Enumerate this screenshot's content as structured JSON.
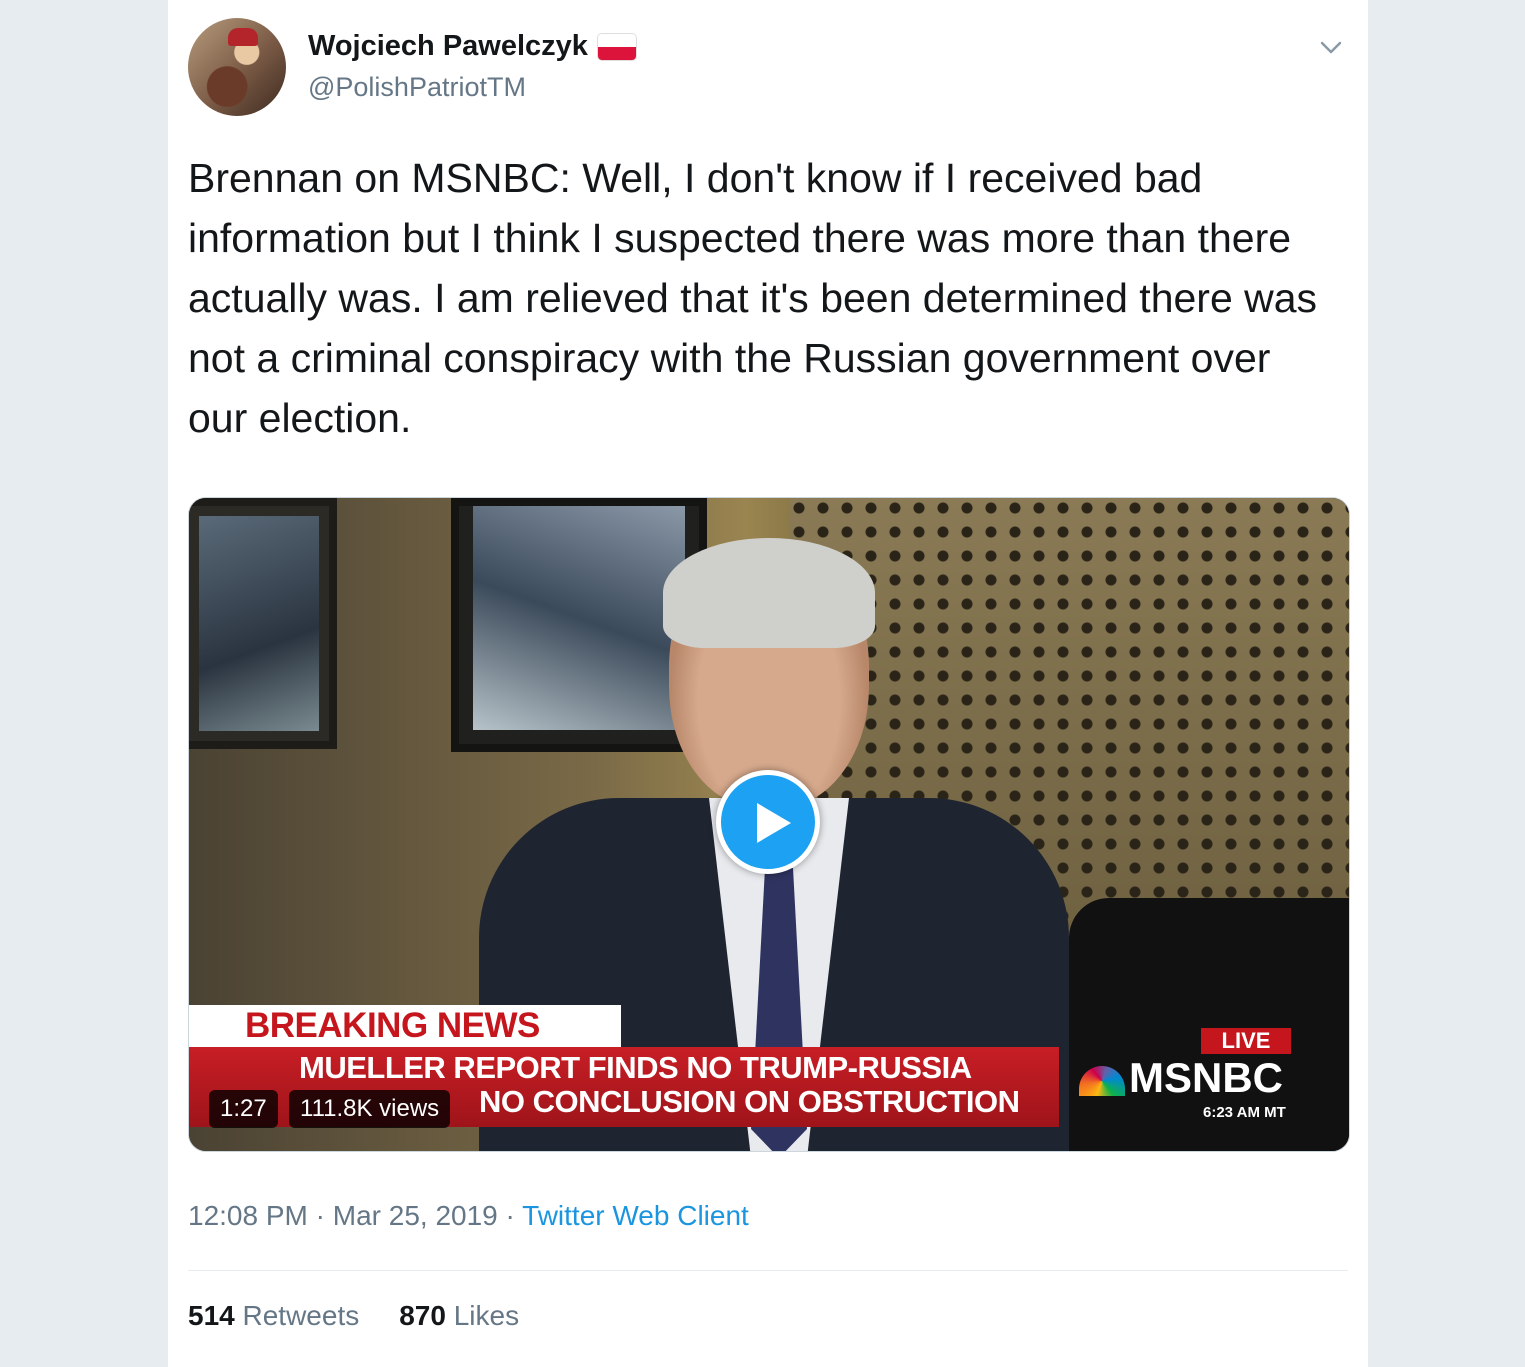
{
  "user": {
    "display_name": "Wojciech Pawelczyk",
    "handle": "@PolishPatriotTM",
    "flag_icon": "poland-flag-icon"
  },
  "tweet": {
    "text": "Brennan on MSNBC: Well, I don't know if I received bad information but I think I suspected there was more than there actually was. I am relieved that it's been determined there was not a criminal conspiracy with the Russian government over our election."
  },
  "video": {
    "duration": "1:27",
    "views": "111.8K views",
    "overlay": {
      "breaking": "BREAKING NEWS",
      "headline_line1": "MUELLER REPORT FINDS NO TRUMP-RUSSIA",
      "headline_line2": "NO CONCLUSION ON OBSTRUCTION",
      "live": "LIVE",
      "network": "MSNBC",
      "clock": "6:23 AM MT"
    }
  },
  "meta": {
    "time": "12:08 PM",
    "separator": " · ",
    "date": "Mar 25, 2019",
    "client": "Twitter Web Client"
  },
  "stats": {
    "retweets_count": "514",
    "retweets_label": "Retweets",
    "likes_count": "870",
    "likes_label": "Likes"
  },
  "colors": {
    "accent": "#1da1f2",
    "link": "#1b95e0",
    "secondary_text": "#657786",
    "background": "#e6ecf0"
  }
}
